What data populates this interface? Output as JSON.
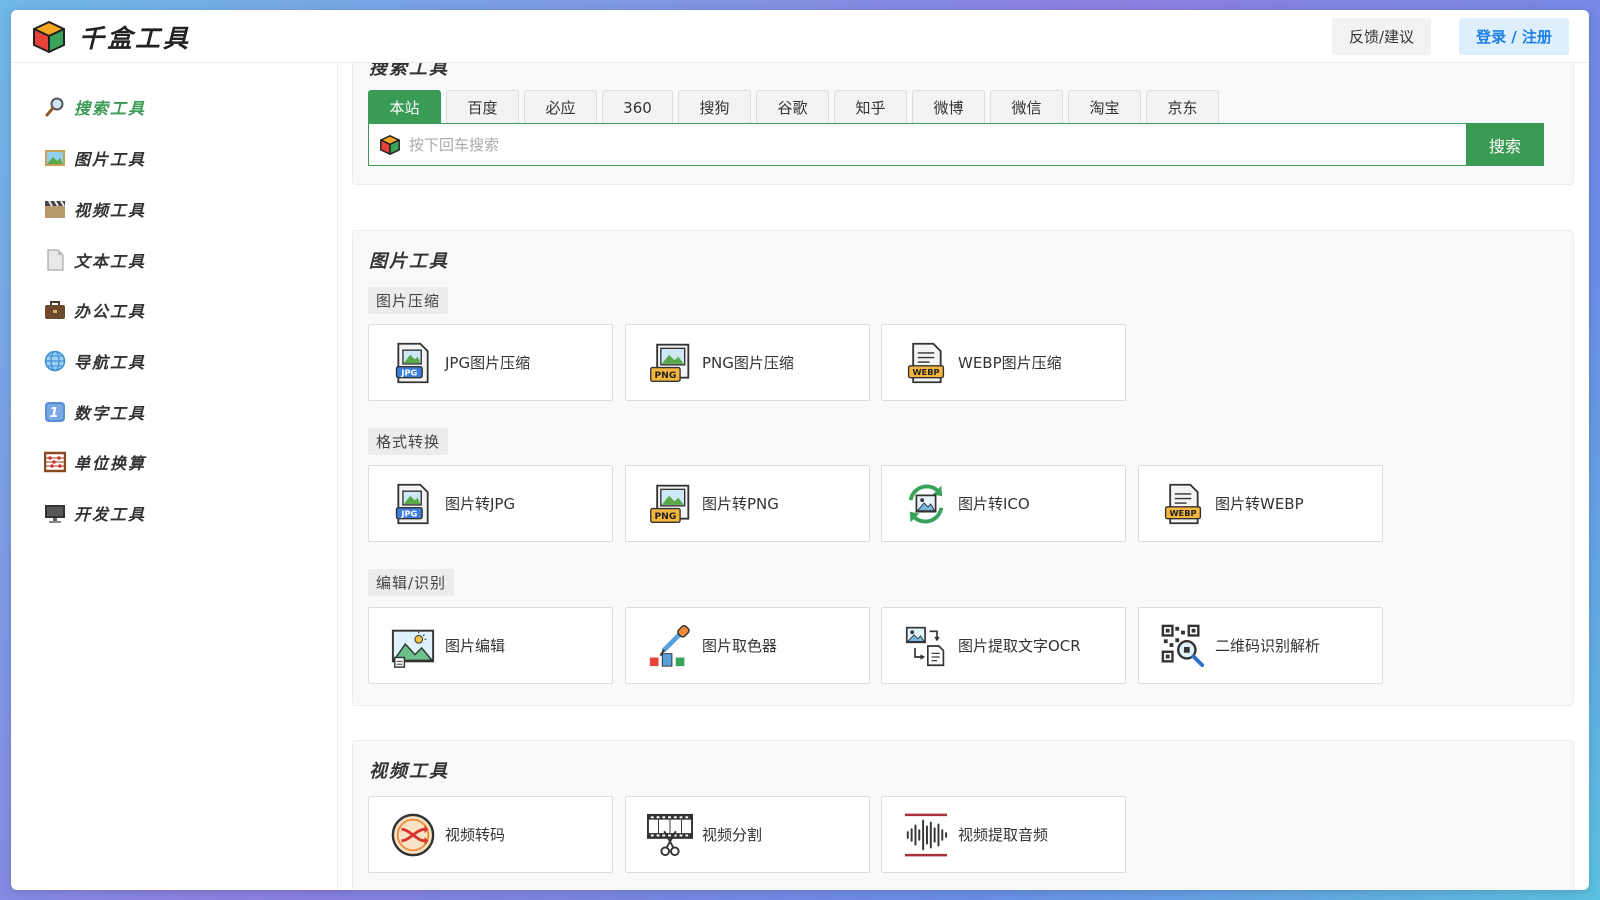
{
  "header": {
    "app_title": "千盒工具",
    "feedback": "反馈/建议",
    "login": "登录 / 注册"
  },
  "sidebar": {
    "items": [
      {
        "label": "搜索工具",
        "icon": "magnifier-icon",
        "active": true
      },
      {
        "label": "图片工具",
        "icon": "picture-icon"
      },
      {
        "label": "视频工具",
        "icon": "clapper-icon"
      },
      {
        "label": "文本工具",
        "icon": "document-icon"
      },
      {
        "label": "办公工具",
        "icon": "briefcase-icon"
      },
      {
        "label": "导航工具",
        "icon": "globe-icon"
      },
      {
        "label": "数字工具",
        "icon": "keycap-one-icon"
      },
      {
        "label": "单位换算",
        "icon": "abacus-icon"
      },
      {
        "label": "开发工具",
        "icon": "monitor-icon"
      }
    ]
  },
  "search_section": {
    "title": "搜索工具",
    "engines": [
      "本站",
      "百度",
      "必应",
      "360",
      "搜狗",
      "谷歌",
      "知乎",
      "微博",
      "微信",
      "淘宝",
      "京东"
    ],
    "active_engine": "本站",
    "placeholder": "按下回车搜索",
    "value": "",
    "button": "搜索"
  },
  "image_section": {
    "title": "图片工具",
    "groups": [
      {
        "label": "图片压缩",
        "tools": [
          {
            "label": "JPG图片压缩",
            "icon": "jpg-file-icon"
          },
          {
            "label": "PNG图片压缩",
            "icon": "png-file-icon"
          },
          {
            "label": "WEBP图片压缩",
            "icon": "webp-file-icon"
          }
        ]
      },
      {
        "label": "格式转换",
        "tools": [
          {
            "label": "图片转JPG",
            "icon": "jpg-file-icon"
          },
          {
            "label": "图片转PNG",
            "icon": "png-file-icon"
          },
          {
            "label": "图片转ICO",
            "icon": "ico-convert-icon"
          },
          {
            "label": "图片转WEBP",
            "icon": "webp-file-icon"
          }
        ]
      },
      {
        "label": "编辑/识别",
        "tools": [
          {
            "label": "图片编辑",
            "icon": "image-edit-icon"
          },
          {
            "label": "图片取色器",
            "icon": "color-picker-icon"
          },
          {
            "label": "图片提取文字OCR",
            "icon": "ocr-icon"
          },
          {
            "label": "二维码识别解析",
            "icon": "qr-scan-icon"
          }
        ]
      }
    ]
  },
  "video_section": {
    "title": "视频工具",
    "tools": [
      {
        "label": "视频转码",
        "icon": "transcode-icon"
      },
      {
        "label": "视频分割",
        "icon": "film-cut-icon"
      },
      {
        "label": "视频提取音频",
        "icon": "audio-wave-icon"
      }
    ]
  },
  "colors": {
    "accent_green": "#3a9b55",
    "login_blue": "#1d7fe6"
  }
}
